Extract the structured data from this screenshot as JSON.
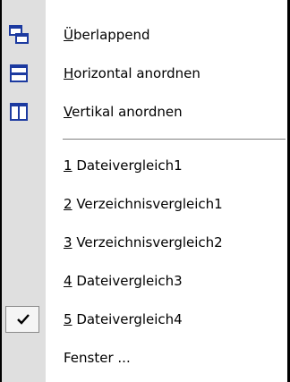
{
  "menu": {
    "colors": {
      "icon_blue": "#1c3aa0",
      "icon_column_bg": "#dfdfdf",
      "separator": "#808080"
    },
    "arrange": [
      {
        "pre": "",
        "key": "Ü",
        "post": "berlappend",
        "icon": "cascade-windows-icon"
      },
      {
        "pre": "",
        "key": "H",
        "post": "orizontal anordnen",
        "icon": "tile-horizontal-icon"
      },
      {
        "pre": "",
        "key": "V",
        "post": "ertikal anordnen",
        "icon": "tile-vertical-icon"
      }
    ],
    "windows": [
      {
        "pre": "",
        "key": "1",
        "post": " Dateivergleich1",
        "checked": false
      },
      {
        "pre": "",
        "key": "2",
        "post": " Verzeichnisvergleich1",
        "checked": false
      },
      {
        "pre": "",
        "key": "3",
        "post": " Verzeichnisvergleich2",
        "checked": false
      },
      {
        "pre": "",
        "key": "4",
        "post": " Dateivergleich3",
        "checked": false
      },
      {
        "pre": "",
        "key": "5",
        "post": " Dateivergleich4",
        "checked": true,
        "check_icon": "checkmark-icon"
      }
    ],
    "more": {
      "label": "Fenster ..."
    }
  }
}
